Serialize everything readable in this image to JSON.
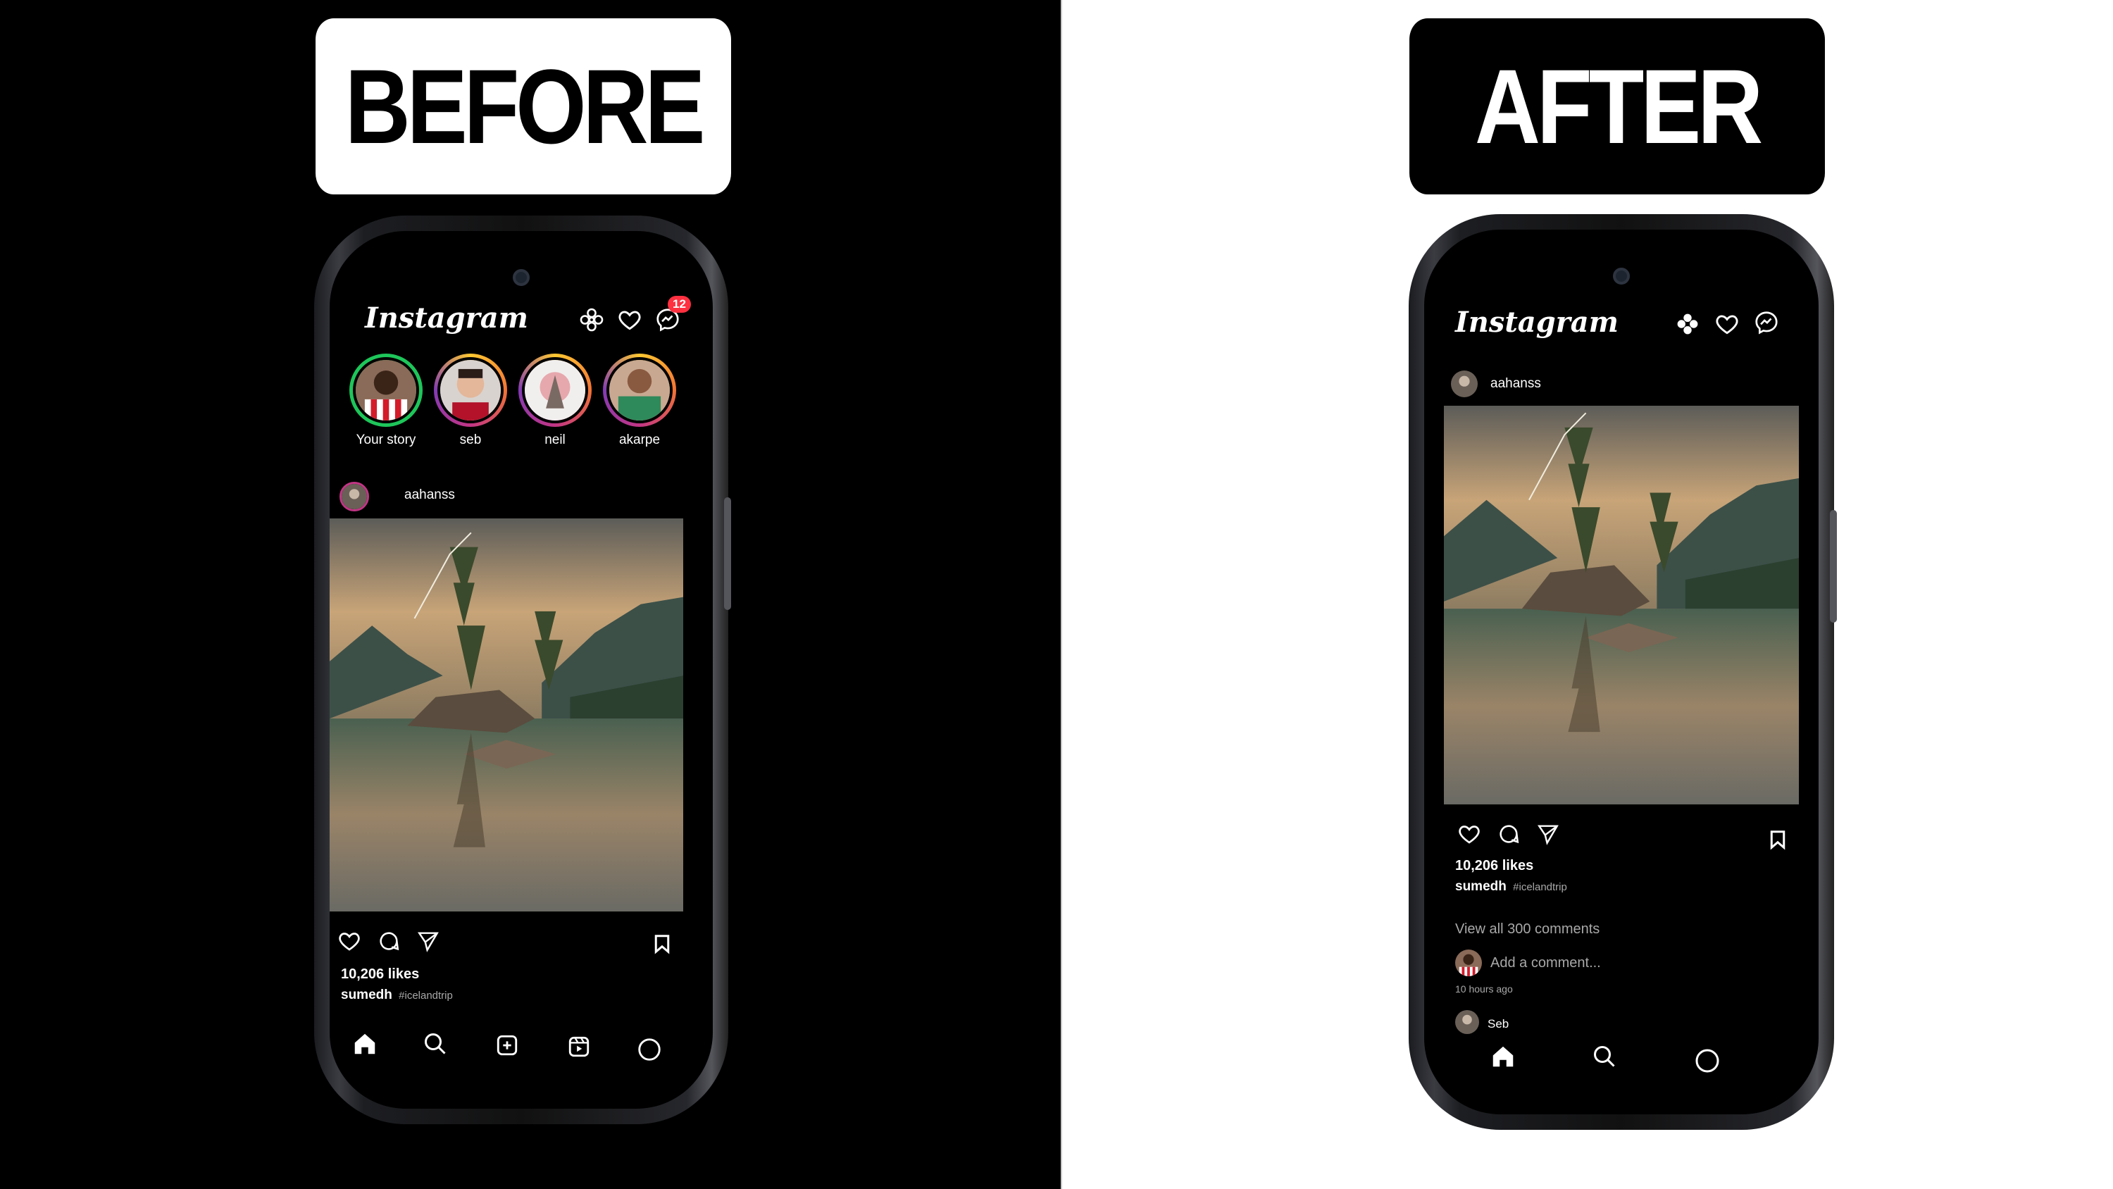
{
  "labels": {
    "before": "BEFORE",
    "after": "AFTER"
  },
  "colors": {
    "left_bg": "#000000",
    "right_bg": "#ffffff",
    "story_ring": "#c13584",
    "badge": "#ff3040"
  },
  "before": {
    "app_title": "Instagram",
    "header_icons": [
      "flower-icon",
      "heart-icon",
      "messenger-icon"
    ],
    "messages_badge": "12",
    "stories": [
      {
        "name": "Your story"
      },
      {
        "name": "seb"
      },
      {
        "name": "neil"
      },
      {
        "name": "akarpe"
      }
    ],
    "post": {
      "username": "aahanss",
      "likes": "10,206 likes",
      "caption_user": "sumedh",
      "caption_tag": "#icelandtrip"
    },
    "bottom_nav": [
      "home-icon",
      "search-icon",
      "create-icon",
      "reels-icon",
      "profile-icon"
    ]
  },
  "after": {
    "app_title": "Instagram",
    "header_icons": [
      "flower-icon",
      "heart-icon",
      "messenger-icon"
    ],
    "post": {
      "username": "aahanss",
      "likes": "10,206 likes",
      "caption_user": "sumedh",
      "caption_tag": "#icelandtrip",
      "view_comments": "View all 300 comments",
      "add_comment_placeholder": "Add a comment...",
      "timestamp": "10 hours ago",
      "next_user": "Seb"
    },
    "bottom_nav": [
      "home-icon",
      "search-icon",
      "profile-icon"
    ]
  }
}
